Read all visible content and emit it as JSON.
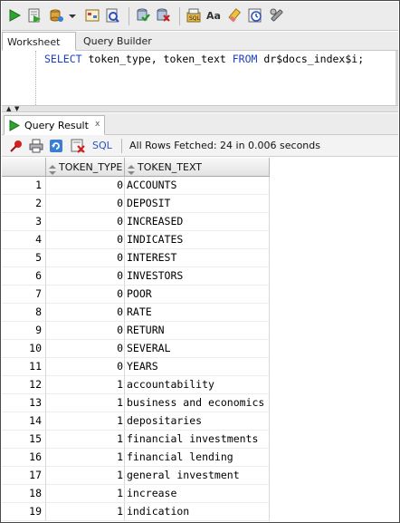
{
  "toolbar": {
    "icons": [
      "run-statement-icon",
      "run-script-icon",
      "connection-icon",
      "dropdown-arrow-icon",
      "explain-plan-icon",
      "autotrace-icon",
      "commit-icon",
      "rollback-icon",
      "sql-tuning-icon",
      "uppercase-icon",
      "clear-icon",
      "history-icon",
      "tools-icon"
    ]
  },
  "editor_tabs": [
    {
      "label": "Worksheet",
      "active": true
    },
    {
      "label": "Query Builder",
      "active": false
    }
  ],
  "editor": {
    "kw_select": "SELECT",
    "columns": " token_type, token_text ",
    "kw_from": "FROM",
    "table": " dr$docs_index$i;"
  },
  "results_tab": {
    "label": "Query Result",
    "close": "x"
  },
  "results_toolbar": {
    "sql_label": "SQL",
    "status": "All Rows Fetched: 24 in 0.006 seconds"
  },
  "grid": {
    "columns": [
      "TOKEN_TYPE",
      "TOKEN_TEXT"
    ],
    "rows": [
      {
        "num": "1",
        "token_type": "0",
        "token_text": "ACCOUNTS"
      },
      {
        "num": "2",
        "token_type": "0",
        "token_text": "DEPOSIT"
      },
      {
        "num": "3",
        "token_type": "0",
        "token_text": "INCREASED"
      },
      {
        "num": "4",
        "token_type": "0",
        "token_text": "INDICATES"
      },
      {
        "num": "5",
        "token_type": "0",
        "token_text": "INTEREST"
      },
      {
        "num": "6",
        "token_type": "0",
        "token_text": "INVESTORS"
      },
      {
        "num": "7",
        "token_type": "0",
        "token_text": "POOR"
      },
      {
        "num": "8",
        "token_type": "0",
        "token_text": "RATE"
      },
      {
        "num": "9",
        "token_type": "0",
        "token_text": "RETURN"
      },
      {
        "num": "10",
        "token_type": "0",
        "token_text": "SEVERAL"
      },
      {
        "num": "11",
        "token_type": "0",
        "token_text": "YEARS"
      },
      {
        "num": "12",
        "token_type": "1",
        "token_text": "accountability"
      },
      {
        "num": "13",
        "token_type": "1",
        "token_text": "business and economics"
      },
      {
        "num": "14",
        "token_type": "1",
        "token_text": "depositaries"
      },
      {
        "num": "15",
        "token_type": "1",
        "token_text": "financial investments"
      },
      {
        "num": "16",
        "token_type": "1",
        "token_text": "financial lending"
      },
      {
        "num": "17",
        "token_type": "1",
        "token_text": "general investment"
      },
      {
        "num": "18",
        "token_type": "1",
        "token_text": "increase"
      },
      {
        "num": "19",
        "token_type": "1",
        "token_text": "indication"
      }
    ]
  }
}
